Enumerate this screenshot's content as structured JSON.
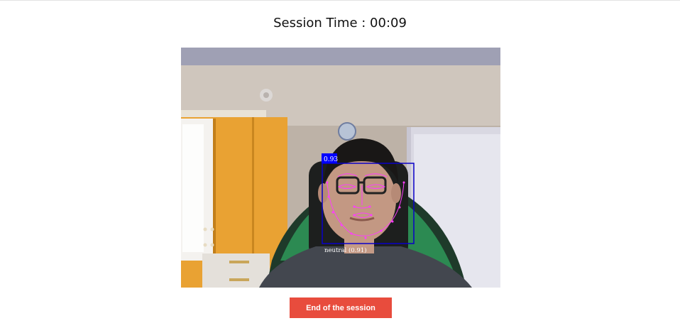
{
  "session": {
    "title": "Session Time : 00:09"
  },
  "detection": {
    "score": "0.93",
    "expression_label": "neutral (0.91)",
    "box_color": "#0a00c8",
    "landmark_color": "#ff3cff"
  },
  "actions": {
    "end_label": "End of the session",
    "end_color": "#e84c3d"
  }
}
